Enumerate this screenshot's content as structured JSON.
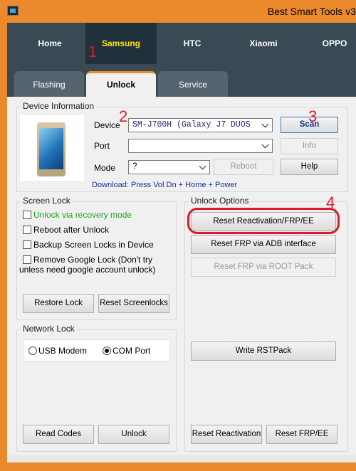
{
  "window": {
    "title": "Best Smart Tools v3"
  },
  "top_tabs": [
    {
      "label": "Home"
    },
    {
      "label": "Samsung",
      "active": true
    },
    {
      "label": "HTC"
    },
    {
      "label": "Xiaomi"
    },
    {
      "label": "OPPO"
    }
  ],
  "sub_tabs": [
    {
      "label": "Flashing"
    },
    {
      "label": "Unlock",
      "active": true
    },
    {
      "label": "Service"
    }
  ],
  "device_info": {
    "legend": "Device Information",
    "device_label": "Device",
    "device_value": "SM-J700H  (Galaxy J7 DUOS",
    "port_label": "Port",
    "port_value": "",
    "mode_label": "Mode",
    "mode_value": "?",
    "reboot_label": "Reboot",
    "scan_label": "Scan",
    "info_label": "Info",
    "help_label": "Help",
    "download_hint": "Download: Press Vol Dn + Home + Power"
  },
  "screen_lock": {
    "legend": "Screen Lock",
    "options": [
      {
        "label": "Unlock via recovery mode",
        "checked": false,
        "color": "#1aa31a"
      },
      {
        "label": "Reboot after Unlock",
        "checked": false
      },
      {
        "label": "Backup Screen Locks in Device",
        "checked": false
      },
      {
        "label": "Remove Google Lock (Don't try unless need google account unlock)",
        "checked": false
      }
    ],
    "restore_label": "Restore Lock",
    "reset_label": "Reset Screenlocks"
  },
  "network_lock": {
    "legend": "Network Lock",
    "usb_modem_label": "USB Modem",
    "com_port_label": "COM Port",
    "selected": "COM Port",
    "read_codes_label": "Read Codes",
    "unlock_label": "Unlock"
  },
  "unlock_options": {
    "legend": "Unlock Options",
    "reset_reactivation_frp_ee_label": "Reset Reactivation/FRP/EE",
    "reset_frp_adb_label": "Reset FRP via ADB interface",
    "reset_frp_root_label": "Reset FRP via ROOT Pack",
    "write_rstpack_label": "Write RSTPack",
    "reset_reactivation_label": "Reset Reactivation",
    "reset_frp_ee_label": "Reset FRP/EE"
  },
  "annotations": [
    "1",
    "2",
    "3",
    "4"
  ],
  "colors": {
    "accent": "#eb8a2d",
    "nav_bg": "#3a4a55",
    "active_tab_text": "#ffe500",
    "annotation_red": "#e0182a"
  }
}
